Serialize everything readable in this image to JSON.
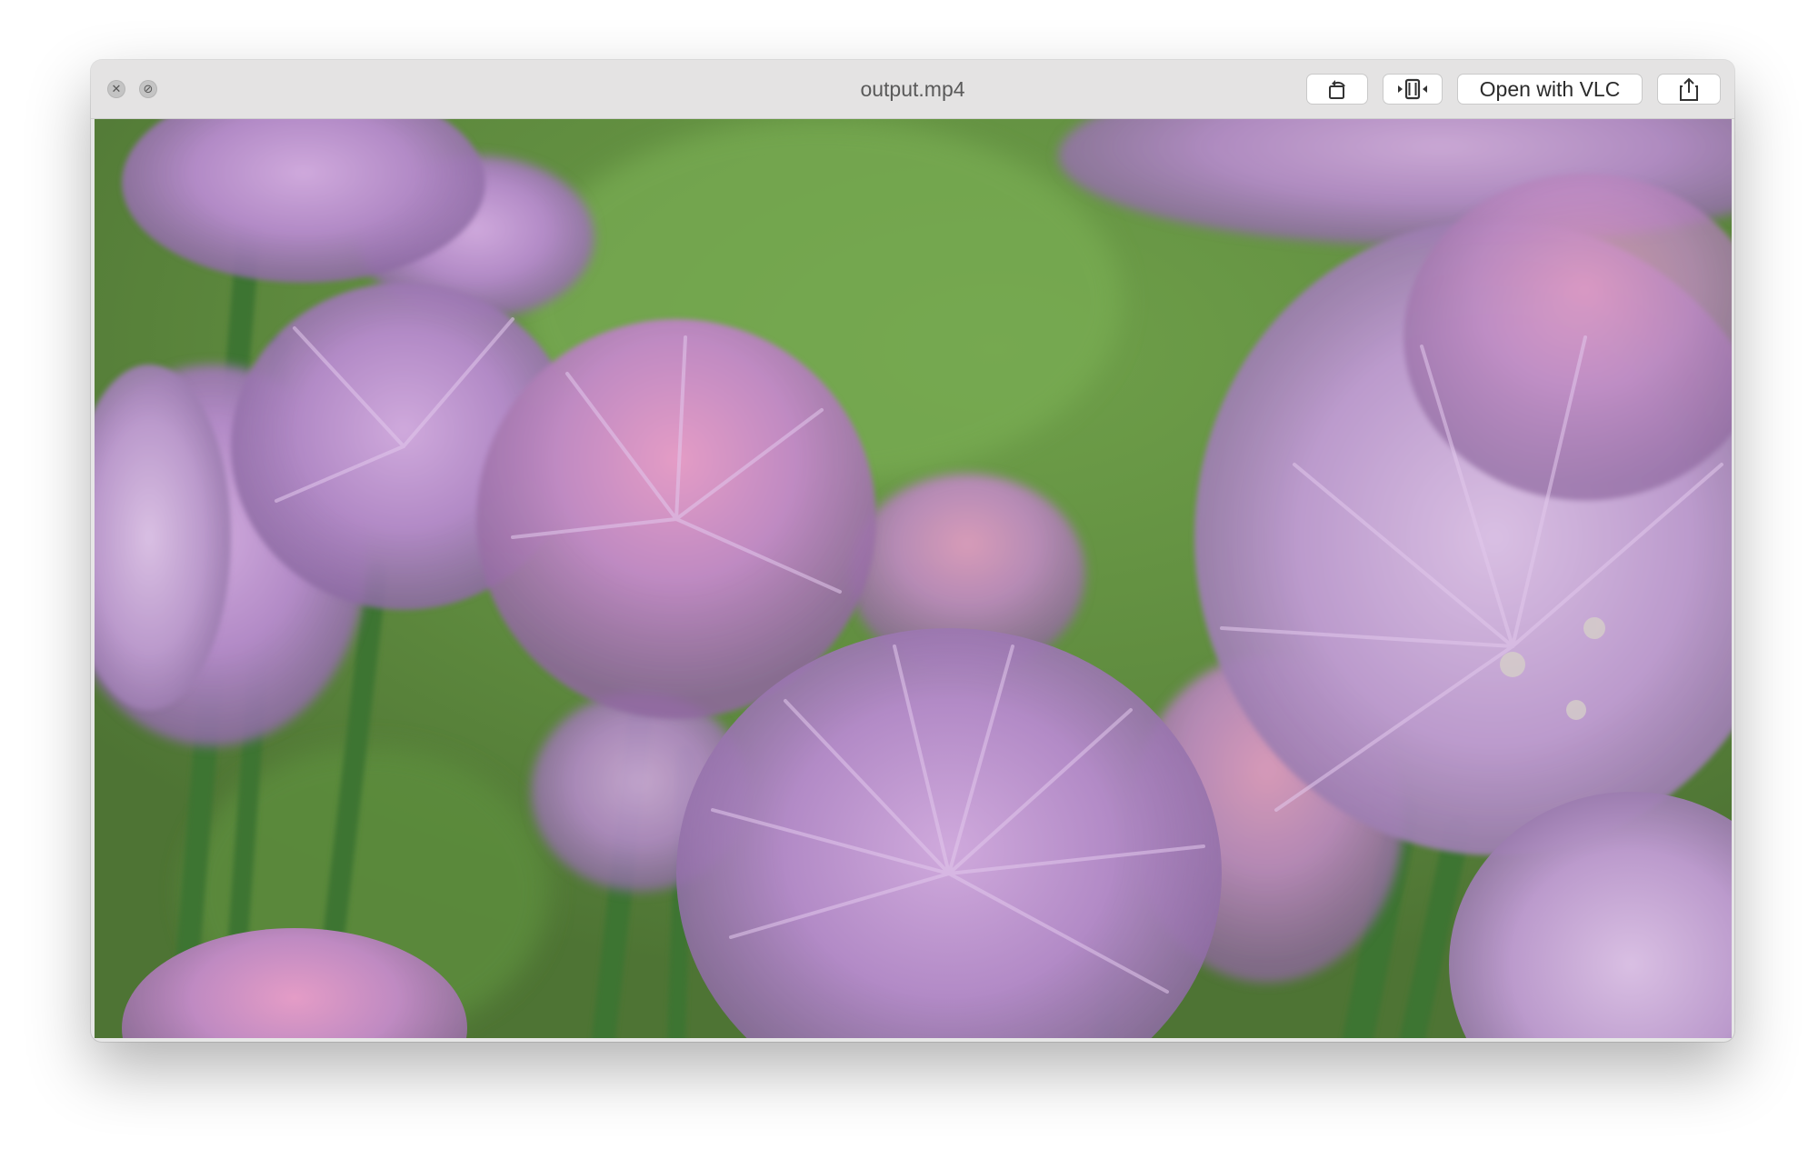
{
  "window": {
    "title": "output.mp4"
  },
  "titlebar": {
    "close_icon": "close-circle-icon",
    "fullscreen_icon": "fullscreen-circle-icon",
    "rotate_icon": "rotate-left-icon",
    "trim_icon": "trim-icon",
    "open_with_label": "Open with VLC",
    "share_icon": "share-icon"
  },
  "colors": {
    "background_green": "#6a8f48",
    "flower_lilac": "#b48cc8",
    "flower_pink": "#d68fb8",
    "stem_green": "#3f7a34"
  }
}
